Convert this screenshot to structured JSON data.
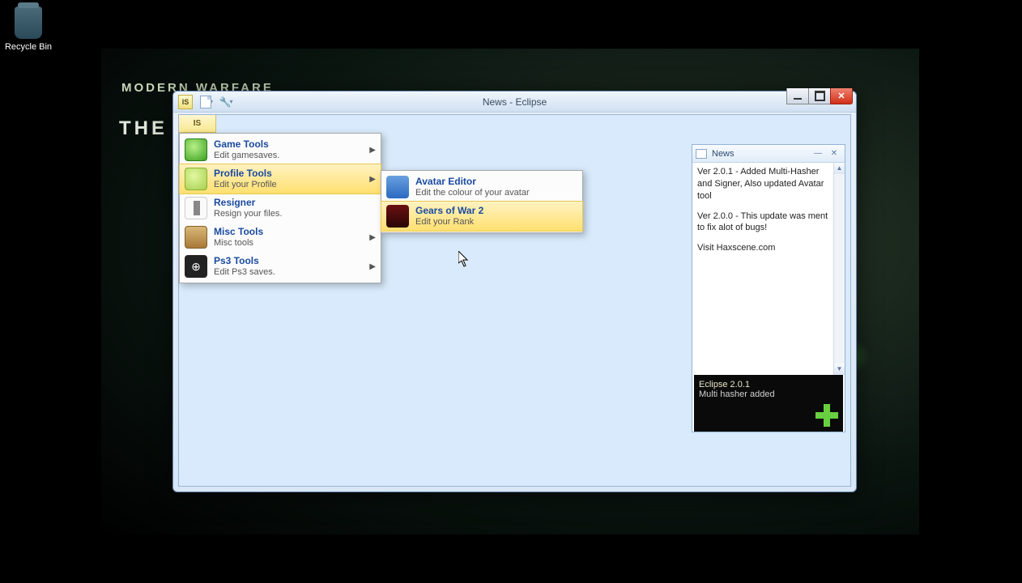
{
  "desktop": {
    "recycle_bin": "Recycle Bin",
    "wallpaper_line1": "MODERN WARFARE",
    "wallpaper_line2": "THE"
  },
  "window": {
    "title": "News - Eclipse",
    "menu_logo": "IS"
  },
  "menu": {
    "items": [
      {
        "title": "Game Tools",
        "desc": "Edit gamesaves.",
        "arrow": true
      },
      {
        "title": "Profile Tools",
        "desc": "Edit your Profile",
        "arrow": true
      },
      {
        "title": "Resigner",
        "desc": "Resign your files.",
        "arrow": false
      },
      {
        "title": "Misc Tools",
        "desc": "Misc tools",
        "arrow": true
      },
      {
        "title": "Ps3 Tools",
        "desc": "Edit Ps3 saves.",
        "arrow": true
      }
    ]
  },
  "submenu": {
    "items": [
      {
        "title": "Avatar Editor",
        "desc": "Edit the colour of your avatar"
      },
      {
        "title": "Gears of War 2",
        "desc": "Edit your Rank"
      }
    ]
  },
  "news": {
    "title": "News",
    "p1": "Ver 2.0.1 - Added Multi-Hasher and Signer, Also updated Avatar tool",
    "p2": "Ver 2.0.0 - This update was ment to fix alot of bugs!",
    "p3": "Visit Haxscene.com",
    "footer_title": "Eclipse 2.0.1",
    "footer_desc": "Multi hasher added"
  }
}
